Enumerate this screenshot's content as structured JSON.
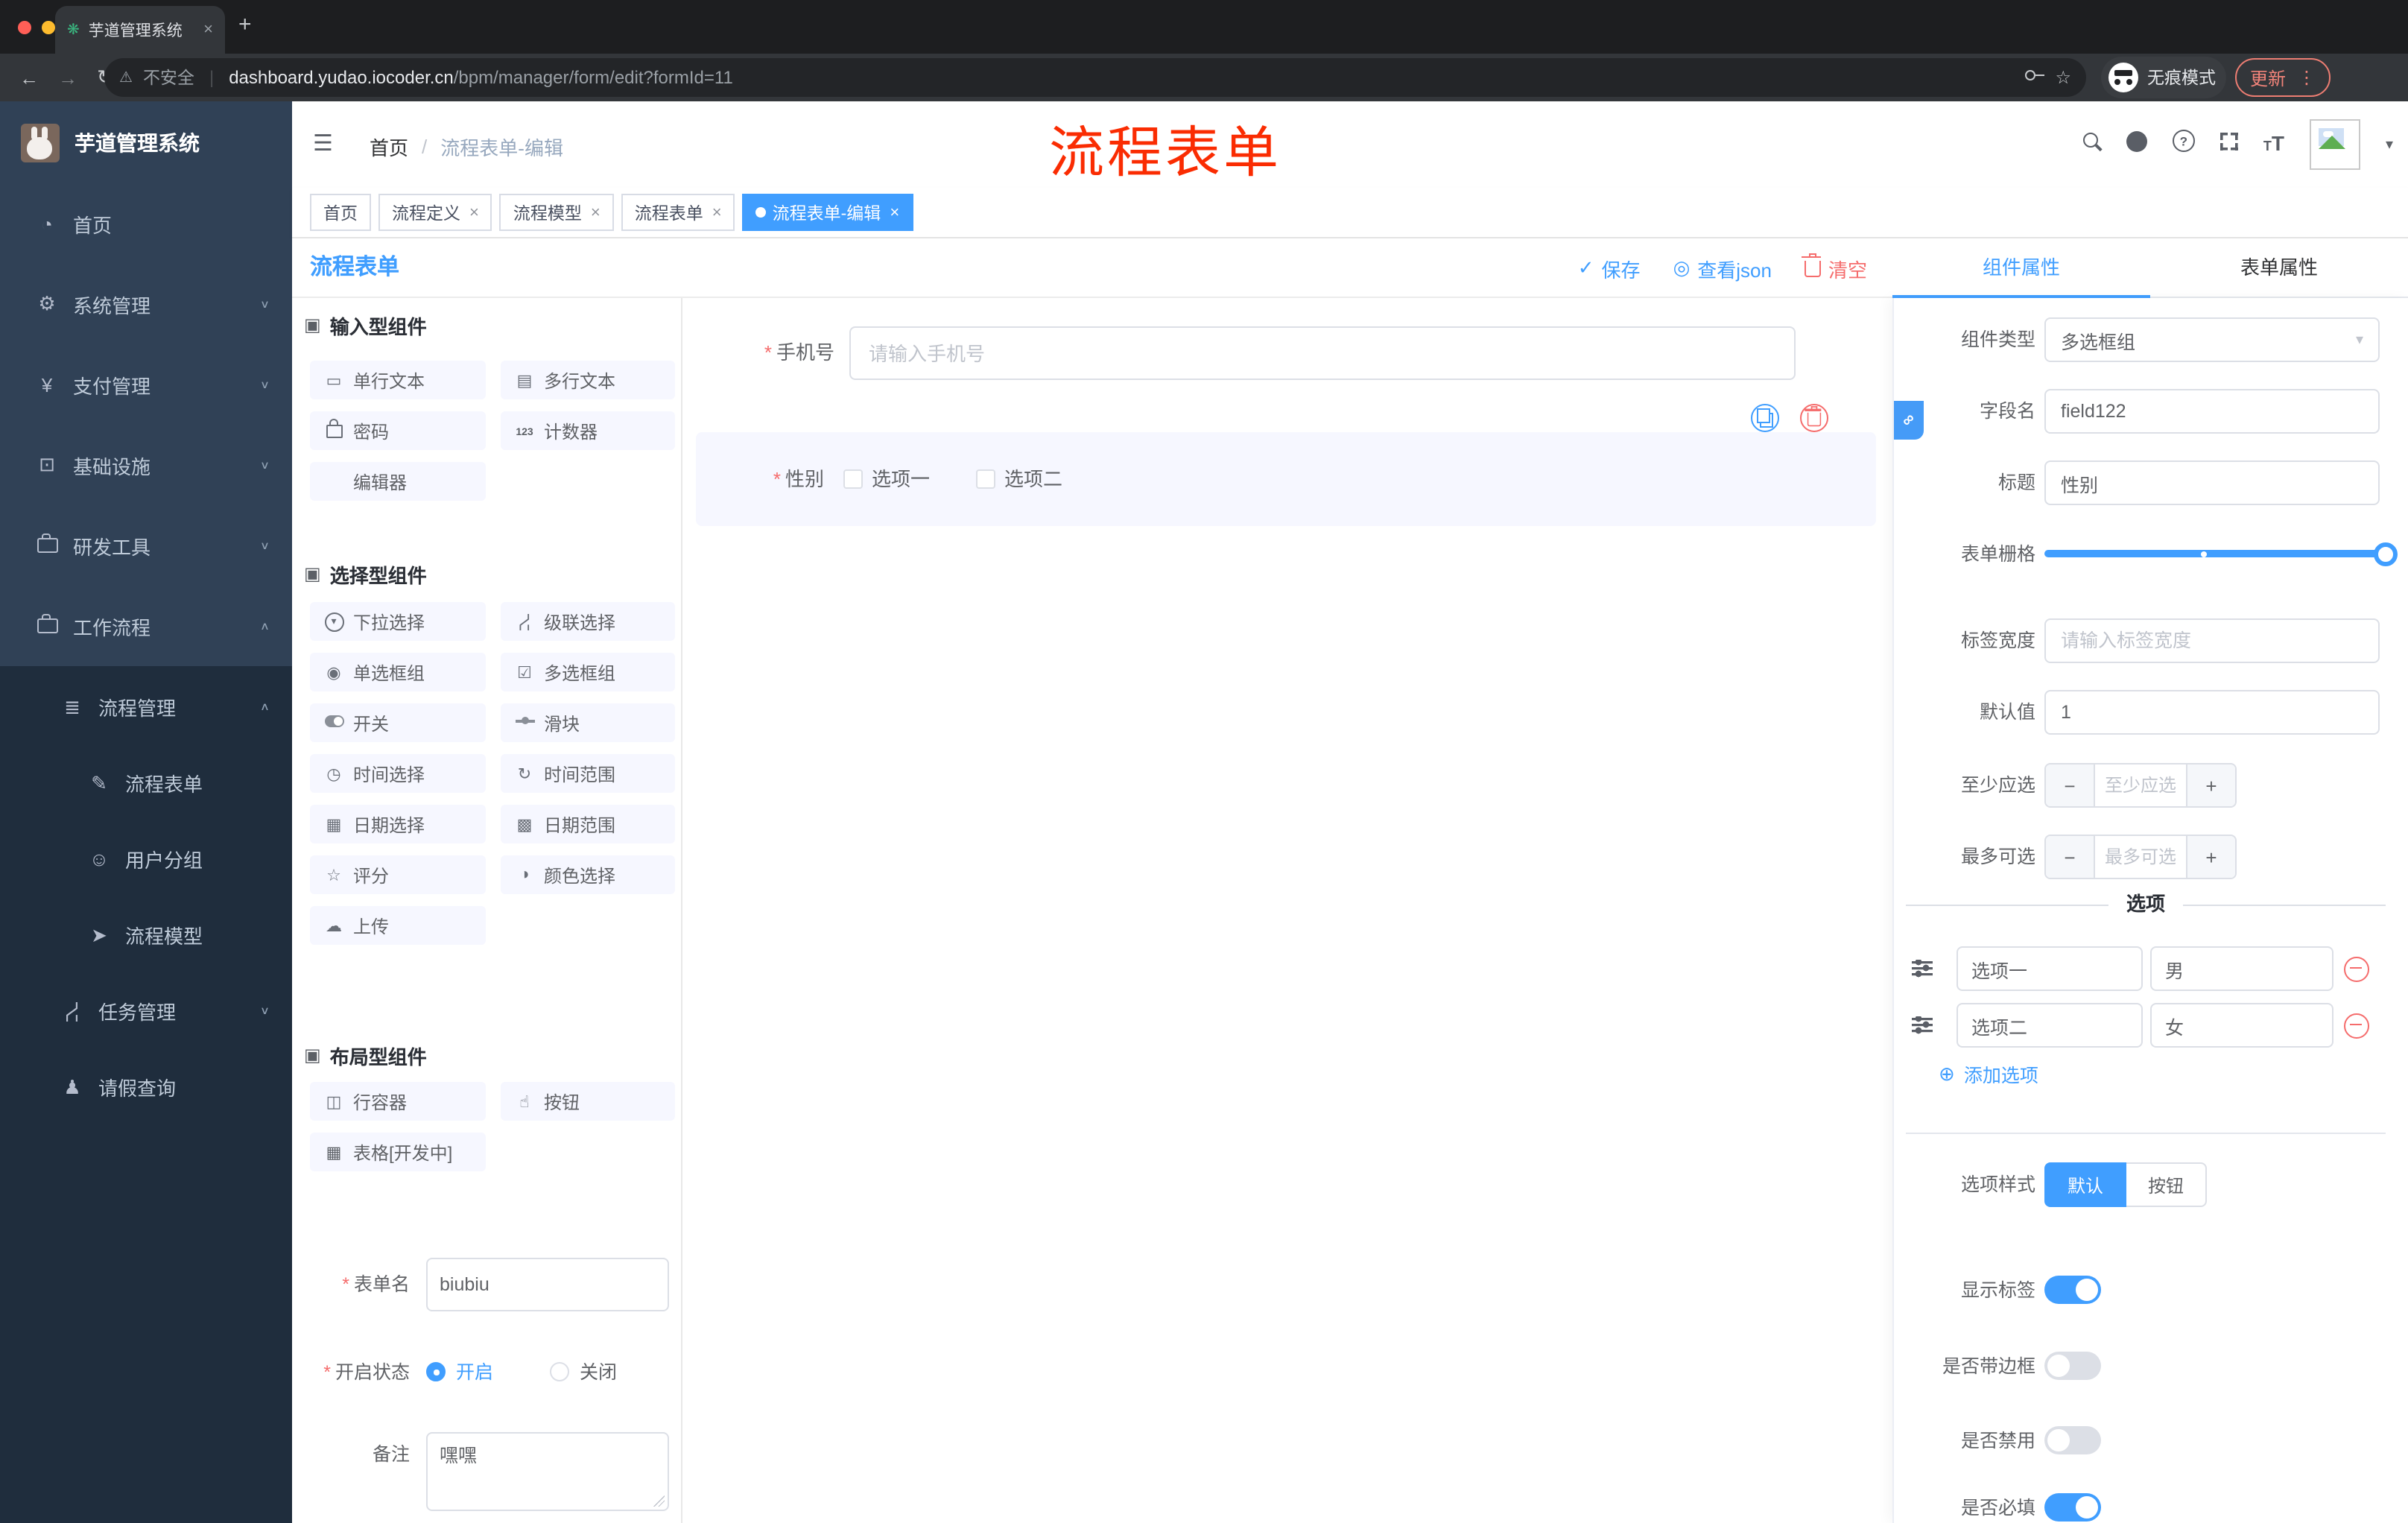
{
  "browser": {
    "tab_title": "芋道管理系统",
    "security": "不安全",
    "url_domain": "dashboard.yudao.iocoder.cn",
    "url_path": "/bpm/manager/form/edit?formId=11",
    "incognito": "无痕模式",
    "update": "更新"
  },
  "sidebar": {
    "title": "芋道管理系统",
    "menu": [
      {
        "key": "home",
        "label": "首页",
        "icon": "dashboard"
      },
      {
        "key": "system",
        "label": "系统管理",
        "icon": "gear",
        "chevron": "down"
      },
      {
        "key": "payment",
        "label": "支付管理",
        "icon": "yen",
        "chevron": "down"
      },
      {
        "key": "infra",
        "label": "基础设施",
        "icon": "monitor",
        "chevron": "down"
      },
      {
        "key": "devtools",
        "label": "研发工具",
        "icon": "case",
        "chevron": "down"
      },
      {
        "key": "workflow",
        "label": "工作流程",
        "icon": "case",
        "chevron": "up"
      }
    ],
    "submenu": [
      {
        "key": "flow-mgmt",
        "label": "流程管理",
        "icon": "flow",
        "level": 2,
        "chevron": "up"
      },
      {
        "key": "flow-form",
        "label": "流程表单",
        "icon": "form",
        "level": 3
      },
      {
        "key": "user-group",
        "label": "用户分组",
        "icon": "group",
        "level": 3
      },
      {
        "key": "flow-model",
        "label": "流程模型",
        "icon": "model",
        "level": 3
      },
      {
        "key": "task-mgmt",
        "label": "任务管理",
        "icon": "task",
        "level": 2,
        "chevron": "down"
      },
      {
        "key": "leave-query",
        "label": "请假查询",
        "icon": "person",
        "level": 2
      }
    ]
  },
  "header": {
    "breadcrumb_home": "首页",
    "breadcrumb_current": "流程表单-编辑",
    "annotation": "流程表单"
  },
  "tags": [
    {
      "key": "home",
      "label": "首页",
      "closable": false,
      "active": false
    },
    {
      "key": "flow-def",
      "label": "流程定义",
      "closable": true,
      "active": false
    },
    {
      "key": "flow-model",
      "label": "流程模型",
      "closable": true,
      "active": false
    },
    {
      "key": "flow-form",
      "label": "流程表单",
      "closable": true,
      "active": false
    },
    {
      "key": "flow-form-edit",
      "label": "流程表单-编辑",
      "closable": true,
      "active": true
    }
  ],
  "toolbar": {
    "title": "流程表单",
    "save": "保存",
    "view_json": "查看json",
    "clear": "清空"
  },
  "palette": {
    "sections": [
      {
        "title": "输入型组件",
        "items": [
          {
            "key": "single-text",
            "label": "单行文本",
            "icon": "rect"
          },
          {
            "key": "multi-text",
            "label": "多行文本",
            "icon": "textarea"
          },
          {
            "key": "password",
            "label": "密码",
            "icon": "lock"
          },
          {
            "key": "counter",
            "label": "计数器",
            "icon": "counter"
          },
          {
            "key": "editor",
            "label": "编辑器",
            "icon": "none"
          }
        ]
      },
      {
        "title": "选择型组件",
        "items": [
          {
            "key": "select",
            "label": "下拉选择",
            "icon": "select"
          },
          {
            "key": "cascade",
            "label": "级联选择",
            "icon": "cascade"
          },
          {
            "key": "radio-group",
            "label": "单选框组",
            "icon": "radio"
          },
          {
            "key": "checkbox-group",
            "label": "多选框组",
            "icon": "checkbox"
          },
          {
            "key": "switch",
            "label": "开关",
            "icon": "switch"
          },
          {
            "key": "slider",
            "label": "滑块",
            "icon": "slider"
          },
          {
            "key": "time",
            "label": "时间选择",
            "icon": "time"
          },
          {
            "key": "time-range",
            "label": "时间范围",
            "icon": "timerange"
          },
          {
            "key": "date",
            "label": "日期选择",
            "icon": "date"
          },
          {
            "key": "date-range",
            "label": "日期范围",
            "icon": "daterange"
          },
          {
            "key": "rate",
            "label": "评分",
            "icon": "star"
          },
          {
            "key": "color",
            "label": "颜色选择",
            "icon": "color"
          },
          {
            "key": "upload",
            "label": "上传",
            "icon": "upload"
          }
        ]
      },
      {
        "title": "布局型组件",
        "items": [
          {
            "key": "row-container",
            "label": "行容器",
            "icon": "row"
          },
          {
            "key": "button",
            "label": "按钮",
            "icon": "button"
          },
          {
            "key": "table",
            "label": "表格[开发中]",
            "icon": "table"
          }
        ]
      }
    ]
  },
  "canvas": {
    "phone_label": "手机号",
    "phone_placeholder": "请输入手机号",
    "gender_label": "性别",
    "gender_options": [
      "选项一",
      "选项二"
    ]
  },
  "meta_form": {
    "name_label": "表单名",
    "name_value": "biubiu",
    "status_label": "开启状态",
    "status_on": "开启",
    "status_off": "关闭",
    "remark_label": "备注",
    "remark_value": "嘿嘿"
  },
  "props": {
    "tab_component": "组件属性",
    "tab_form": "表单属性",
    "comp_type_label": "组件类型",
    "comp_type_value": "多选框组",
    "field_label": "字段名",
    "field_value": "field122",
    "title_label": "标题",
    "title_value": "性别",
    "grid_label": "表单栅格",
    "label_width_label": "标签宽度",
    "label_width_placeholder": "请输入标签宽度",
    "default_label": "默认值",
    "default_value": "1",
    "min_label": "至少应选",
    "min_placeholder": "至少应选",
    "max_label": "最多可选",
    "max_placeholder": "最多可选",
    "options_title": "选项",
    "options": [
      {
        "text": "选项一",
        "value": "男"
      },
      {
        "text": "选项二",
        "value": "女"
      }
    ],
    "add_option": "添加选项",
    "style_label": "选项样式",
    "style_default": "默认",
    "style_button": "按钮",
    "toggles": [
      {
        "key": "show-label",
        "label": "显示标签",
        "on": true
      },
      {
        "key": "border",
        "label": "是否带边框",
        "on": false
      },
      {
        "key": "disabled",
        "label": "是否禁用",
        "on": false
      },
      {
        "key": "required",
        "label": "是否必填",
        "on": true
      }
    ]
  }
}
